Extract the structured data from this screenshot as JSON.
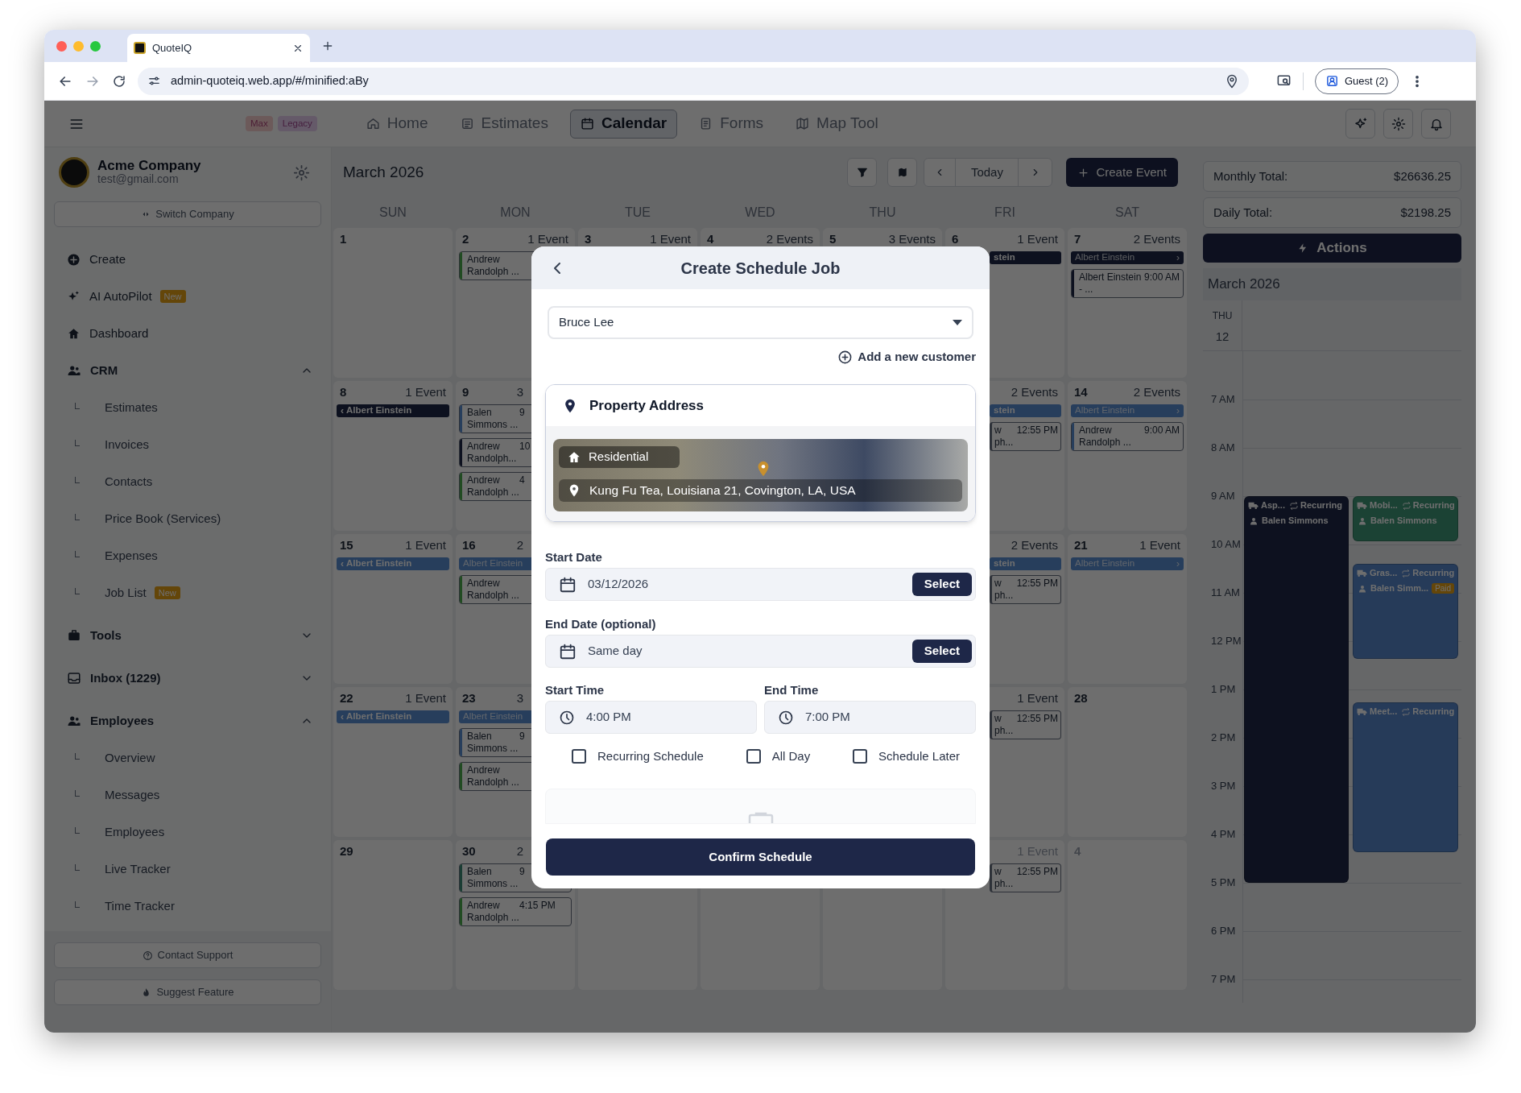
{
  "browser": {
    "tab_title": "QuoteIQ",
    "url": "admin-quoteiq.web.app/#/minified:aBy",
    "profile": "Guest (2)"
  },
  "app_header": {
    "badges": [
      {
        "label": "Max",
        "color": "#6c5a5a"
      },
      {
        "label": "Legacy",
        "color": "#645a69"
      }
    ],
    "nav": [
      {
        "label": "Home",
        "selected": false
      },
      {
        "label": "Estimates",
        "selected": false
      },
      {
        "label": "Calendar",
        "selected": true
      },
      {
        "label": "Forms",
        "selected": false
      },
      {
        "label": "Map Tool",
        "selected": false
      }
    ]
  },
  "sidebar": {
    "company": "Acme Company",
    "email": "test@gmail.com",
    "switch_label": "Switch Company",
    "items": [
      {
        "kind": "link",
        "label": "Create"
      },
      {
        "kind": "link",
        "label": "AI AutoPilot",
        "badge": "New"
      },
      {
        "kind": "link",
        "label": "Dashboard"
      },
      {
        "kind": "section",
        "label": "CRM",
        "expanded": true,
        "children": [
          {
            "label": "Estimates"
          },
          {
            "label": "Invoices"
          },
          {
            "label": "Contacts"
          },
          {
            "label": "Price Book (Services)"
          },
          {
            "label": "Expenses"
          },
          {
            "label": "Job List",
            "badge": "New"
          }
        ]
      },
      {
        "kind": "section",
        "label": "Tools",
        "expanded": false
      },
      {
        "kind": "section",
        "label": "Inbox (1229)",
        "expanded": false
      },
      {
        "kind": "section",
        "label": "Employees",
        "expanded": true,
        "children": [
          {
            "label": "Overview"
          },
          {
            "label": "Messages"
          },
          {
            "label": "Employees"
          },
          {
            "label": "Live Tracker"
          },
          {
            "label": "Time Tracker"
          }
        ]
      }
    ],
    "footer": [
      "Contact Support",
      "Suggest Feature"
    ]
  },
  "calendar": {
    "month": "March 2026",
    "today": "Today",
    "create": "Create Event",
    "weekdays": [
      "SUN",
      "MON",
      "TUE",
      "WED",
      "THU",
      "FRI",
      "SAT"
    ],
    "weeks": [
      {
        "cells": [
          {
            "day": "1",
            "other_month": false
          },
          {
            "day": "2",
            "count": "1 Event",
            "other_month": false,
            "events": [
              {
                "kind": "card",
                "name": "Andrew Randolph ...",
                "color": "#214b22"
              }
            ]
          },
          {
            "day": "3",
            "count": "1 Event",
            "other_month": false
          },
          {
            "day": "4",
            "count": "2 Events",
            "other_month": false
          },
          {
            "day": "5",
            "count": "3 Events",
            "other_month": false
          },
          {
            "day": "6",
            "count": "1 Event",
            "other_month": false,
            "events": [
              {
                "kind": "banner",
                "label": "stein",
                "color": "#0d111f",
                "faded": false
              }
            ]
          },
          {
            "day": "7",
            "count": "2 Events",
            "other_month": false,
            "events": [
              {
                "kind": "banner",
                "label": "Albert Einstein",
                "color": "#0d111f",
                "faded": true,
                "arrow_right": "›"
              },
              {
                "kind": "card",
                "name": "Albert Einstein - ...",
                "time": "9:00 AM",
                "color": "#0d111f"
              }
            ]
          }
        ]
      },
      {
        "left_cells": [
          {
            "day": "8",
            "count": "1 Event",
            "other_month": false,
            "events": [
              {
                "kind": "banner",
                "label": "Albert Einstein",
                "color": "#0d111f",
                "faded": false,
                "arrow_left": "‹"
              }
            ]
          },
          {
            "day": "9",
            "count": "3",
            "other_month": false,
            "events": [
              {
                "kind": "card",
                "name": "Balen Simmons ...",
                "time": "9",
                "color": "#273e5c"
              },
              {
                "kind": "card",
                "name": "Andrew Randolph...",
                "time": "10",
                "color": "#0d111f"
              },
              {
                "kind": "card",
                "name": "Andrew Randolph ...",
                "time": "4",
                "color": "#214b22"
              }
            ]
          }
        ],
        "right_cells": [
          {
            "count": "2 Events",
            "other_month": false,
            "events": [
              {
                "kind": "banner",
                "label": "stein",
                "color": "#273e5c",
                "faded": false
              },
              {
                "kind": "card",
                "name": "w ph...",
                "time": "12:55 PM"
              }
            ]
          },
          {
            "day": "14",
            "count": "2 Events",
            "other_month": false,
            "events": [
              {
                "kind": "banner",
                "label": "Albert Einstein",
                "color": "#273e5c",
                "faded": true,
                "arrow_right": "›"
              },
              {
                "kind": "card",
                "name": "Andrew Randolph ...",
                "time": "9:00 AM",
                "color": "#273e5c"
              }
            ]
          }
        ]
      },
      {
        "left_cells": [
          {
            "day": "15",
            "count": "1 Event",
            "other_month": false,
            "events": [
              {
                "kind": "banner",
                "label": "Albert Einstein",
                "color": "#273e5c",
                "faded": false,
                "arrow_left": "‹"
              }
            ]
          },
          {
            "day": "16",
            "count": "2",
            "other_month": false,
            "events": [
              {
                "kind": "banner",
                "label": "Albert Einstein",
                "color": "#273e5c",
                "faded": true
              },
              {
                "kind": "card",
                "name": "Andrew Randolph ...",
                "color": "#214b22"
              }
            ]
          }
        ],
        "right_cells": [
          {
            "count": "2 Events",
            "other_month": false,
            "events": [
              {
                "kind": "banner",
                "label": "stein",
                "color": "#273e5c",
                "faded": false
              },
              {
                "kind": "card",
                "name": "w ph...",
                "time": "12:55 PM"
              }
            ]
          },
          {
            "day": "21",
            "count": "1 Event",
            "other_month": false,
            "events": [
              {
                "kind": "banner",
                "label": "Albert Einstein",
                "color": "#273e5c",
                "faded": true,
                "arrow_right": "›"
              }
            ]
          }
        ]
      },
      {
        "left_cells": [
          {
            "day": "22",
            "count": "1 Event",
            "other_month": false,
            "events": [
              {
                "kind": "banner",
                "label": "Albert Einstein",
                "color": "#273e5c",
                "faded": false,
                "arrow_left": "‹"
              }
            ]
          },
          {
            "day": "23",
            "count": "3",
            "other_month": false,
            "events": [
              {
                "kind": "banner",
                "label": "Albert Einstein",
                "color": "#273e5c",
                "faded": true
              },
              {
                "kind": "card",
                "name": "Balen Simmons ...",
                "time": "9",
                "color": "#273e5c"
              },
              {
                "kind": "card",
                "name": "Andrew Randolph ...",
                "color": "#214b22"
              }
            ]
          }
        ],
        "right_cells": [
          {
            "count": "1 Event",
            "other_month": false,
            "events": [
              {
                "kind": "card",
                "name": "w ph...",
                "time": "12:55 PM"
              }
            ]
          },
          {
            "day": "28",
            "other_month": false
          }
        ]
      },
      {
        "left_cells": [
          {
            "day": "29",
            "other_month": false
          },
          {
            "day": "30",
            "count": "2",
            "other_month": false,
            "events": [
              {
                "kind": "card",
                "name": "Balen Simmons ...",
                "time": "9",
                "color": "#1a3d34"
              },
              {
                "kind": "card",
                "name": "Andrew Randolph ...",
                "time": "4:15 PM",
                "color": "#214b22"
              }
            ]
          }
        ],
        "right_cells": [
          {
            "count": "1 Event",
            "other_month": true,
            "events": [
              {
                "kind": "card",
                "name": "w ph...",
                "time": "12:55 PM"
              }
            ]
          },
          {
            "day": "4",
            "other_month": true
          }
        ]
      }
    ]
  },
  "day_panel": {
    "totals": [
      {
        "label": "Monthly Total:",
        "value": "$26636.25"
      },
      {
        "label": "Daily Total:",
        "value": "$2198.25"
      }
    ],
    "actions": "Actions",
    "month": "March 2026",
    "weekday": "THU",
    "day": "12",
    "hours": [
      "7 AM",
      "8 AM",
      "9 AM",
      "10 AM",
      "11 AM",
      "12 PM",
      "1 PM",
      "2 PM",
      "3 PM",
      "4 PM",
      "5 PM",
      "6 PM",
      "7 PM"
    ],
    "events": [
      {
        "title": "Asp...",
        "tag": "Recurring",
        "assignee": "Balen Simmons",
        "color": "#0d111f"
      },
      {
        "title": "Mobi...",
        "tag": "Recurring",
        "assignee": "Balen Simmons",
        "color": "#1b4234"
      },
      {
        "title": "Gras...",
        "tag": "Recurring",
        "assignee": "Balen Simm...",
        "badge": "Paid",
        "color": "#263b59"
      },
      {
        "title": "Meet...",
        "tag": "Recurring",
        "color": "#263b59"
      }
    ]
  },
  "modal": {
    "title": "Create Schedule Job",
    "customer": "Bruce Lee",
    "add_customer": "Add a new customer",
    "property": {
      "heading": "Property Address",
      "type": "Residential",
      "address": "Kung Fu Tea, Louisiana 21, Covington, LA, USA"
    },
    "dates": [
      {
        "label": "Start Date",
        "value": "03/12/2026",
        "button": "Select"
      },
      {
        "label": "End Date (optional)",
        "value": "Same day",
        "button": "Select"
      }
    ],
    "times": [
      {
        "label": "Start Time",
        "value": "4:00 PM"
      },
      {
        "label": "End Time",
        "value": "7:00 PM"
      }
    ],
    "options": [
      {
        "label": "Recurring Schedule",
        "checked": false
      },
      {
        "label": "All Day",
        "checked": false
      },
      {
        "label": "Schedule Later",
        "checked": false
      }
    ],
    "confirm": "Confirm Schedule"
  }
}
